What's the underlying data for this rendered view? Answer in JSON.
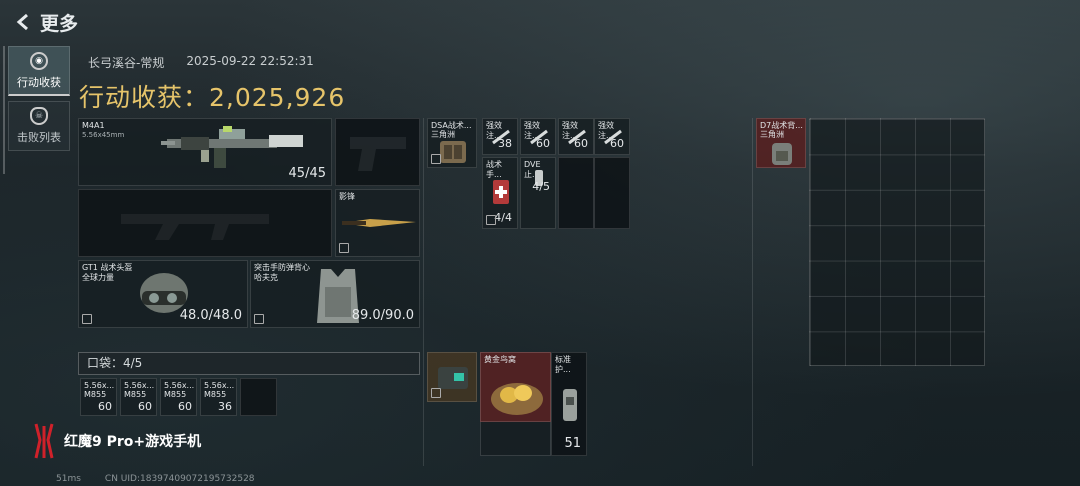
{
  "header": {
    "title": "更多"
  },
  "tabs": [
    {
      "label": "行动收获",
      "active": true
    },
    {
      "label": "击败列表",
      "active": false
    }
  ],
  "info": {
    "map": "长弓溪谷-常规",
    "timestamp": "2025-09-22 22:52:31"
  },
  "harvest": {
    "text": "行动收获：2,025,926"
  },
  "weapons": {
    "primary": {
      "name": "M4A1",
      "caliber": "5.56x45mm",
      "ammo": "45/45"
    },
    "melee": {
      "name": "影锋"
    }
  },
  "gear": {
    "helmet": {
      "name": "GT1 战术头盔",
      "brand": "全球力量",
      "durability": "48.0/48.0"
    },
    "armor": {
      "name": "突击手防弹背心",
      "brand": "哈夫克",
      "durability": "89.0/90.0"
    }
  },
  "pouch": {
    "label": "口袋：4/5",
    "items": [
      {
        "name": "5.56x...",
        "sub": "M855",
        "qty": "60"
      },
      {
        "name": "5.56x...",
        "sub": "M855",
        "qty": "60"
      },
      {
        "name": "5.56x...",
        "sub": "M855",
        "qty": "60"
      },
      {
        "name": "5.56x...",
        "sub": "M855",
        "qty": "36"
      }
    ]
  },
  "rig": {
    "name": "DSA战术...",
    "sub": "三角洲",
    "items": [
      {
        "name": "强效注...",
        "qty": "38"
      },
      {
        "name": "强效注...",
        "qty": "60"
      },
      {
        "name": "强效注...",
        "qty": "60"
      },
      {
        "name": "强效注...",
        "qty": "60"
      },
      {
        "name": "战术手...",
        "qty": "4/4"
      },
      {
        "name": "DVE止...",
        "qty": "4/5"
      }
    ]
  },
  "backpack": {
    "name": "D7战术背...",
    "sub": "三角洲"
  },
  "case": {
    "items": [
      {
        "name": "黄金鸟窝"
      },
      {
        "name": "标准护...",
        "qty": "51"
      }
    ]
  },
  "brand": {
    "text": "红魔9 Pro+游戏手机"
  },
  "footer": {
    "ping": "51ms",
    "uid": "CN UID:18397409072195732528"
  },
  "colors": {
    "accent": "#e6c46a",
    "brand_red": "#d0212a"
  }
}
